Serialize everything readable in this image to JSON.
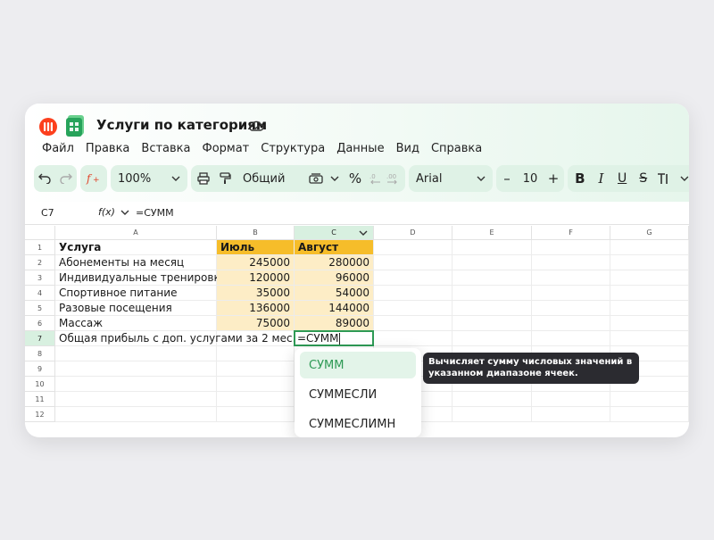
{
  "app": {
    "title": "Услуги по категориям"
  },
  "menu": [
    "Файл",
    "Правка",
    "Вставка",
    "Формат",
    "Структура",
    "Данные",
    "Вид",
    "Справка"
  ],
  "toolbar": {
    "zoom": "100%",
    "number_format": "Общий",
    "percent": "%",
    "font": "Arial",
    "font_size": "10",
    "minus": "–",
    "plus": "+",
    "bold": "B",
    "italic": "I",
    "underline": "U",
    "strike": "S"
  },
  "formula_bar": {
    "cell_ref": "C7",
    "fx_label": "f(x)",
    "formula": "=СУММ"
  },
  "columns": [
    "A",
    "B",
    "C",
    "D",
    "E",
    "F",
    "G"
  ],
  "rows": [
    "1",
    "2",
    "3",
    "4",
    "5",
    "6",
    "7",
    "8",
    "9",
    "10",
    "11",
    "12"
  ],
  "table": {
    "header": [
      "Услуга",
      "Июль",
      "Август"
    ],
    "body": [
      [
        "Абонементы на месяц",
        "245000",
        "280000"
      ],
      [
        "Индивидуальные тренировки",
        "120000",
        "96000"
      ],
      [
        "Спортивное питание",
        "35000",
        "54000"
      ],
      [
        "Разовые посещения",
        "136000",
        "144000"
      ],
      [
        "Массаж",
        "75000",
        "89000"
      ]
    ],
    "total_label": "Общая прибыль с доп. услугами за 2 мес.",
    "total_input": "=СУММ"
  },
  "autocomplete": {
    "items": [
      "СУММ",
      "СУММЕСЛИ",
      "СУММЕСЛИМН"
    ],
    "tooltip": "Вычисляет сумму числовых значений в указанном диапазоне ячеек."
  },
  "colors": {
    "accent": "#2e9a55",
    "header_fill": "#f6bd2a",
    "data_fill": "#fdedc6",
    "toolbar_fill": "#dff2e6"
  }
}
